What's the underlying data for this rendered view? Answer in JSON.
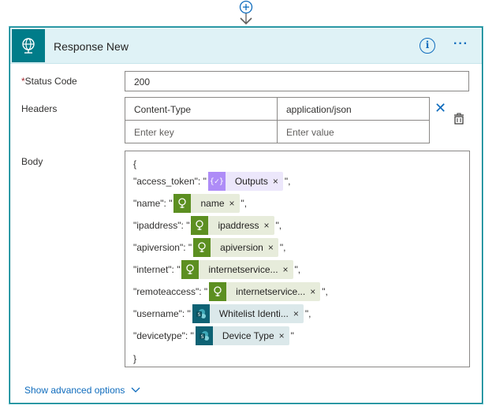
{
  "card": {
    "title": "Response New",
    "info_glyph": "i",
    "more_glyph": "···",
    "header_icon": "globe-icon",
    "accent": "#007c89"
  },
  "status": {
    "label": "Status Code",
    "required_mark": "*",
    "value": "200"
  },
  "headers": {
    "label": "Headers",
    "key_value": "Content-Type",
    "value_value": "application/json",
    "key_placeholder": "Enter key",
    "value_placeholder": "Enter value",
    "delete_glyph": "✕"
  },
  "body": {
    "label": "Body",
    "open_brace": "{",
    "close_brace": "}",
    "lines": [
      {
        "key": "\"access_token\": \"",
        "token": "Outputs",
        "icon": "expression-icon",
        "kind": "purple",
        "tail": "\","
      },
      {
        "key": "\"name\": \"",
        "token": "name",
        "icon": "bulb-icon",
        "kind": "green",
        "tail": "\","
      },
      {
        "key": "\"ipaddress\": \"",
        "token": "ipaddress",
        "icon": "bulb-icon",
        "kind": "green",
        "tail": "\","
      },
      {
        "key": "\"apiversion\": \"",
        "token": "apiversion",
        "icon": "bulb-icon",
        "kind": "green",
        "tail": "\","
      },
      {
        "key": "\"internet\": \"",
        "token": "internetservice...",
        "icon": "bulb-icon",
        "kind": "green",
        "tail": "\","
      },
      {
        "key": "\"remoteaccess\": \"",
        "token": "internetservice...",
        "icon": "bulb-icon",
        "kind": "green",
        "tail": "\","
      },
      {
        "key": "\"username\": \"",
        "token": "Whitelist Identi...",
        "icon": "sharepoint-icon",
        "kind": "teal",
        "tail": "\","
      },
      {
        "key": "\"devicetype\": \"",
        "token": "Device Type",
        "icon": "sharepoint-icon",
        "kind": "teal",
        "tail": "\""
      }
    ],
    "token_remove_glyph": "×"
  },
  "advanced": {
    "label": "Show advanced options"
  }
}
